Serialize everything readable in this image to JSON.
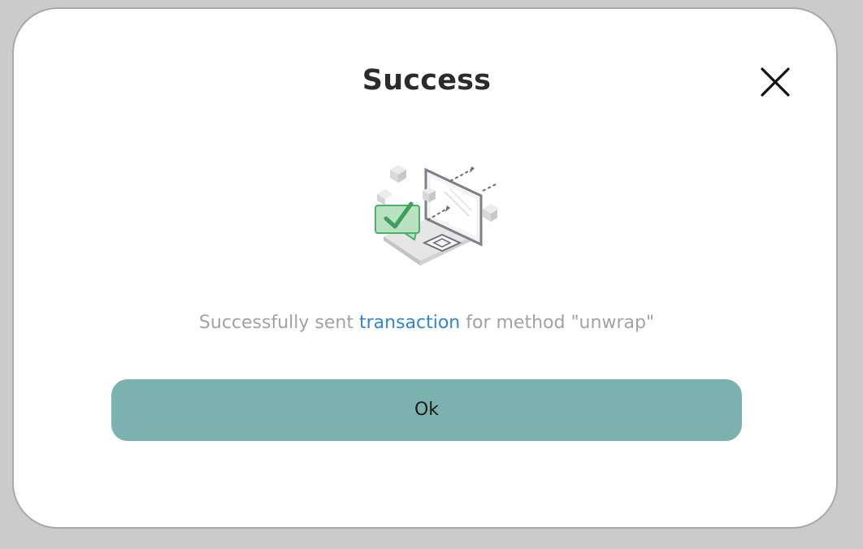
{
  "dialog": {
    "title": "Success",
    "message_prefix": "Successfully sent ",
    "message_link": "transaction",
    "message_suffix": " for method \"unwrap\"",
    "ok_label": "Ok"
  },
  "icons": {
    "close": "close-icon",
    "illustration": "success-transaction-illustration"
  },
  "colors": {
    "button_bg": "#7bb2af",
    "link": "#2f86d6",
    "check_green": "#4caf6a"
  }
}
